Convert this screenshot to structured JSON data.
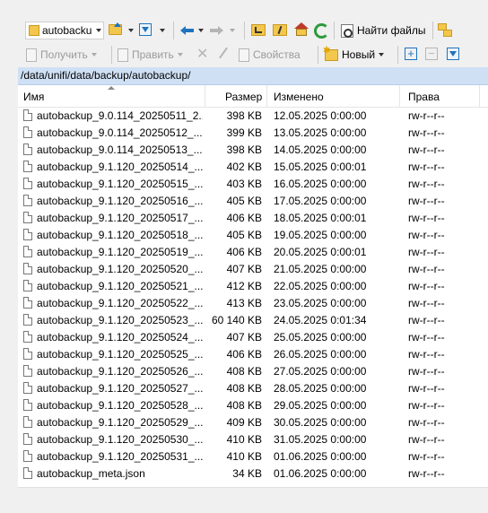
{
  "toolbar1": {
    "location_label": "autobacku",
    "find_files_label": "Найти файлы"
  },
  "toolbar2": {
    "download_label": "Получить",
    "edit_label": "Править",
    "properties_label": "Свойства",
    "new_label": "Новый"
  },
  "path": "/data/unifi/data/backup/autobackup/",
  "columns": {
    "name": "Имя",
    "size": "Размер",
    "modified": "Изменено",
    "rights": "Права"
  },
  "files": [
    {
      "name": "autobackup_9.0.114_20250511_2...",
      "size": "398 KB",
      "modified": "12.05.2025 0:00:00",
      "rights": "rw-r--r--"
    },
    {
      "name": "autobackup_9.0.114_20250512_...",
      "size": "399 KB",
      "modified": "13.05.2025 0:00:00",
      "rights": "rw-r--r--"
    },
    {
      "name": "autobackup_9.0.114_20250513_...",
      "size": "398 KB",
      "modified": "14.05.2025 0:00:00",
      "rights": "rw-r--r--"
    },
    {
      "name": "autobackup_9.1.120_20250514_...",
      "size": "402 KB",
      "modified": "15.05.2025 0:00:01",
      "rights": "rw-r--r--"
    },
    {
      "name": "autobackup_9.1.120_20250515_...",
      "size": "403 KB",
      "modified": "16.05.2025 0:00:00",
      "rights": "rw-r--r--"
    },
    {
      "name": "autobackup_9.1.120_20250516_...",
      "size": "405 KB",
      "modified": "17.05.2025 0:00:00",
      "rights": "rw-r--r--"
    },
    {
      "name": "autobackup_9.1.120_20250517_...",
      "size": "406 KB",
      "modified": "18.05.2025 0:00:01",
      "rights": "rw-r--r--"
    },
    {
      "name": "autobackup_9.1.120_20250518_...",
      "size": "405 KB",
      "modified": "19.05.2025 0:00:00",
      "rights": "rw-r--r--"
    },
    {
      "name": "autobackup_9.1.120_20250519_...",
      "size": "406 KB",
      "modified": "20.05.2025 0:00:01",
      "rights": "rw-r--r--"
    },
    {
      "name": "autobackup_9.1.120_20250520_...",
      "size": "407 KB",
      "modified": "21.05.2025 0:00:00",
      "rights": "rw-r--r--"
    },
    {
      "name": "autobackup_9.1.120_20250521_...",
      "size": "412 KB",
      "modified": "22.05.2025 0:00:00",
      "rights": "rw-r--r--"
    },
    {
      "name": "autobackup_9.1.120_20250522_...",
      "size": "413 KB",
      "modified": "23.05.2025 0:00:00",
      "rights": "rw-r--r--"
    },
    {
      "name": "autobackup_9.1.120_20250523_...",
      "size": "60 140 KB",
      "modified": "24.05.2025 0:01:34",
      "rights": "rw-r--r--"
    },
    {
      "name": "autobackup_9.1.120_20250524_...",
      "size": "407 KB",
      "modified": "25.05.2025 0:00:00",
      "rights": "rw-r--r--"
    },
    {
      "name": "autobackup_9.1.120_20250525_...",
      "size": "406 KB",
      "modified": "26.05.2025 0:00:00",
      "rights": "rw-r--r--"
    },
    {
      "name": "autobackup_9.1.120_20250526_...",
      "size": "408 KB",
      "modified": "27.05.2025 0:00:00",
      "rights": "rw-r--r--"
    },
    {
      "name": "autobackup_9.1.120_20250527_...",
      "size": "408 KB",
      "modified": "28.05.2025 0:00:00",
      "rights": "rw-r--r--"
    },
    {
      "name": "autobackup_9.1.120_20250528_...",
      "size": "408 KB",
      "modified": "29.05.2025 0:00:00",
      "rights": "rw-r--r--"
    },
    {
      "name": "autobackup_9.1.120_20250529_...",
      "size": "409 KB",
      "modified": "30.05.2025 0:00:00",
      "rights": "rw-r--r--"
    },
    {
      "name": "autobackup_9.1.120_20250530_...",
      "size": "410 KB",
      "modified": "31.05.2025 0:00:00",
      "rights": "rw-r--r--"
    },
    {
      "name": "autobackup_9.1.120_20250531_...",
      "size": "410 KB",
      "modified": "01.06.2025 0:00:00",
      "rights": "rw-r--r--"
    },
    {
      "name": "autobackup_meta.json",
      "size": "34 KB",
      "modified": "01.06.2025 0:00:00",
      "rights": "rw-r--r--"
    }
  ],
  "icons": {
    "folder": "folder-icon",
    "filter": "filter-icon",
    "back": "back-arrow-icon",
    "forward": "forward-arrow-icon",
    "parent": "parent-folder-icon",
    "root": "root-folder-icon",
    "home": "home-icon",
    "refresh": "refresh-icon",
    "find": "find-files-icon",
    "sync": "sync-browse-icon"
  },
  "colors": {
    "path_bar_bg": "#cfe0f5",
    "accent_blue": "#1e73be",
    "folder_yellow": "#f3c64c",
    "refresh_green": "#2e9a3a"
  }
}
